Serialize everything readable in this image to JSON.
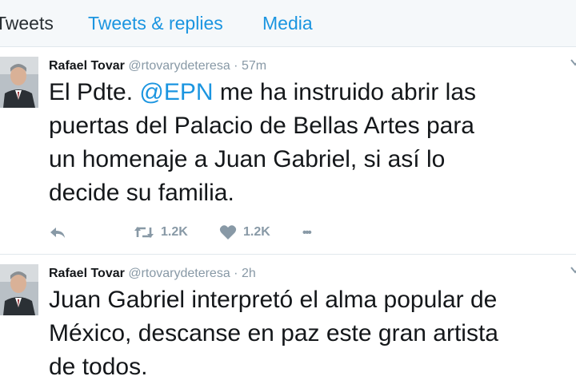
{
  "tabs": [
    "Tweets",
    "Tweets & replies",
    "Media"
  ],
  "tweets": [
    {
      "name": "Rafael Tovar",
      "handle": "@rtovarydeteresa",
      "dot": "·",
      "time": "57m",
      "text_before": "El Pdte. ",
      "mention": "@EPN",
      "text_after": " me ha instruido abrir las\npuertas del Palacio de Bellas Artes para\nun homenaje a Juan Gabriel, si así lo\ndecide su familia.",
      "retweets": "1.2K",
      "likes": "1.2K",
      "more": "•••"
    },
    {
      "name": "Rafael Tovar",
      "handle": "@rtovarydeteresa",
      "dot": "·",
      "time": "2h",
      "text": "Juan Gabriel interpretó el alma popular de\nMéxico, descanse en paz este gran artista\nde todos."
    }
  ],
  "colors": {
    "link": "#1b95e0",
    "muted": "#8899a6",
    "text": "#14171a"
  }
}
